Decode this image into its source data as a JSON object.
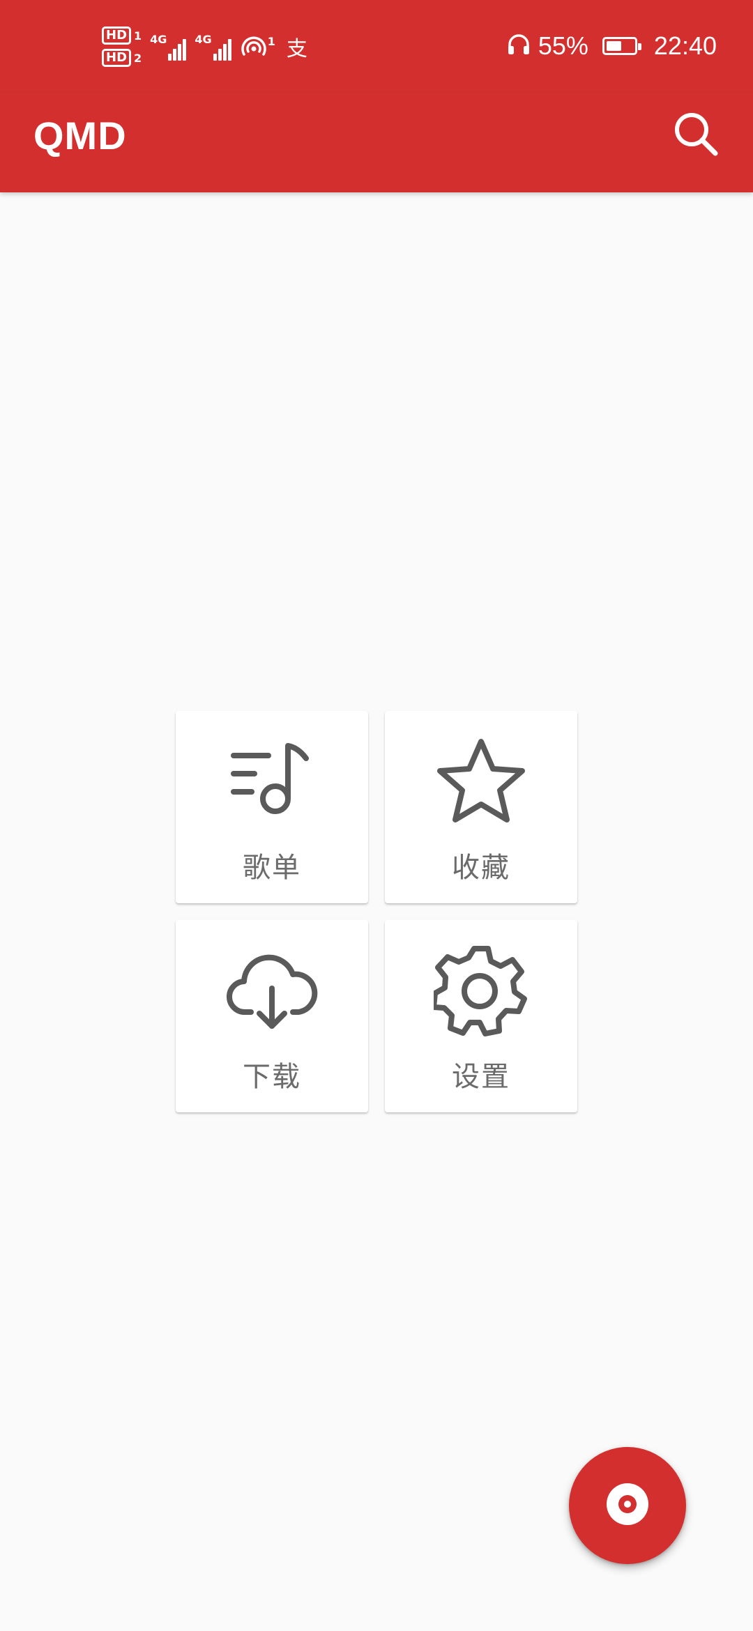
{
  "status_bar": {
    "sim1_badge": "HD",
    "sim1_num": "1",
    "sim2_badge": "HD",
    "sim2_num": "2",
    "network_1": "4G",
    "network_2": "4G",
    "hotspot_count": "1",
    "pay_icon": "支",
    "battery_percent": "55%",
    "battery_level": 0.55,
    "time": "22:40"
  },
  "app_bar": {
    "title": "QMD",
    "search_icon": "search-icon"
  },
  "menu": [
    {
      "label": "歌单",
      "icon": "playlist-icon"
    },
    {
      "label": "收藏",
      "icon": "star-icon"
    },
    {
      "label": "下载",
      "icon": "cloud-download-icon"
    },
    {
      "label": "设置",
      "icon": "settings-icon"
    }
  ],
  "fab": {
    "icon": "disc-icon"
  },
  "colors": {
    "primary": "#d32f2f",
    "background": "#fafafa",
    "icon": "#5a5a5a",
    "label": "#6b6b6b"
  }
}
